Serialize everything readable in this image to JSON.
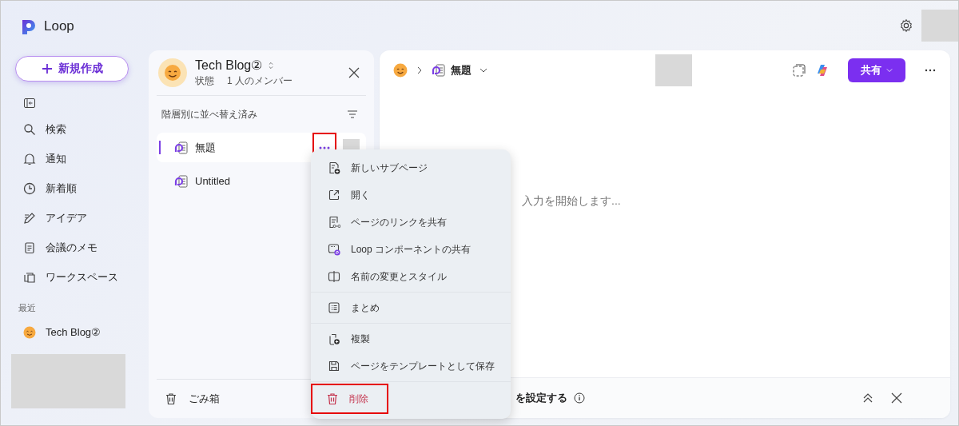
{
  "app": {
    "name": "Loop"
  },
  "sidebar": {
    "new_button": "新規作成",
    "items": [
      {
        "label": "検索"
      },
      {
        "label": "通知"
      },
      {
        "label": "新着順"
      },
      {
        "label": "アイデア"
      },
      {
        "label": "会議のメモ"
      },
      {
        "label": "ワークスペース"
      }
    ],
    "recent": {
      "heading": "最近",
      "items": [
        {
          "label": "Tech Blog②"
        }
      ]
    }
  },
  "workspace": {
    "name": "Tech Blog②",
    "status": "状態",
    "members": "1 人のメンバー",
    "sort_label": "階層別に並べ替え済み",
    "pages": [
      {
        "title": "無題",
        "selected": true
      },
      {
        "title": "Untitled",
        "selected": false
      }
    ],
    "more_button": {
      "highlighted": true
    },
    "trash": "ごみ箱"
  },
  "editor": {
    "breadcrumb_page": "無題",
    "share_button": "共有",
    "placeholder": "入力を開始します...",
    "bottom_bar_text": "を設定する"
  },
  "context_menu": {
    "groups": [
      [
        {
          "label": "新しいサブページ",
          "danger": false,
          "highlighted": false
        },
        {
          "label": "開く",
          "danger": false,
          "highlighted": false
        },
        {
          "label": "ページのリンクを共有",
          "danger": false,
          "highlighted": false
        },
        {
          "label": "Loop コンポーネントの共有",
          "danger": false,
          "highlighted": false
        },
        {
          "label": "名前の変更とスタイル",
          "danger": false,
          "highlighted": false
        }
      ],
      [
        {
          "label": "まとめ",
          "danger": false,
          "highlighted": false
        }
      ],
      [
        {
          "label": "複製",
          "danger": false,
          "highlighted": false
        },
        {
          "label": "ページをテンプレートとして保存",
          "danger": false,
          "highlighted": false
        }
      ],
      [
        {
          "label": "削除",
          "danger": true,
          "highlighted": true
        }
      ]
    ]
  }
}
